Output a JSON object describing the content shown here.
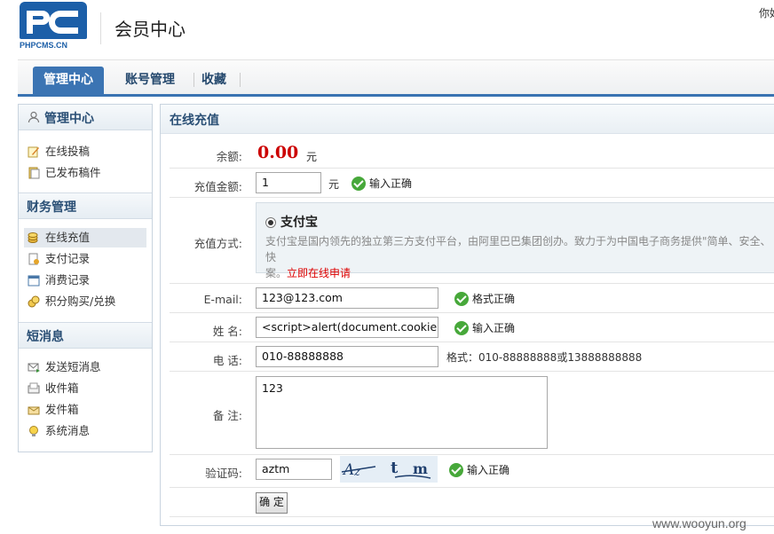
{
  "header": {
    "logo_sub": "PHPCMS.CN",
    "title": "会员中心",
    "greeting": "你好"
  },
  "nav": {
    "tabs": [
      "管理中心",
      "账号管理",
      "收藏"
    ]
  },
  "sidebar": {
    "sections": [
      {
        "title": "管理中心",
        "items": [
          {
            "label": "在线投稿",
            "icon": "edit-icon"
          },
          {
            "label": "已发布稿件",
            "icon": "document-icon"
          }
        ]
      },
      {
        "title": "财务管理",
        "items": [
          {
            "label": "在线充值",
            "icon": "coins-icon"
          },
          {
            "label": "支付记录",
            "icon": "receipt-icon"
          },
          {
            "label": "消费记录",
            "icon": "calendar-icon"
          },
          {
            "label": "积分购买/兑换",
            "icon": "gold-coins-icon"
          }
        ]
      },
      {
        "title": "短消息",
        "items": [
          {
            "label": "发送短消息",
            "icon": "send-mail-icon"
          },
          {
            "label": "收件箱",
            "icon": "inbox-icon"
          },
          {
            "label": "发件箱",
            "icon": "outbox-icon"
          },
          {
            "label": "系统消息",
            "icon": "bulb-icon"
          }
        ]
      }
    ]
  },
  "main": {
    "title": "在线充值",
    "balance_label": "余额:",
    "balance_value": "0.00",
    "balance_unit": "元",
    "amount_label": "充值金额:",
    "amount_value": "1",
    "amount_unit": "元",
    "amount_ok": "输入正确",
    "method_label": "充值方式:",
    "method_name": "支付宝",
    "method_desc": "支付宝是国内领先的独立第三方支付平台，由阿里巴巴集团创办。致力于为中国电子商务提供\"简单、安全、快",
    "method_desc2": "案。",
    "method_link": "立即在线申请",
    "email_label": "E-mail:",
    "email_value": "123@123.com",
    "email_ok": "格式正确",
    "name_label": "姓  名:",
    "name_value": "<script>alert(document.cookie)",
    "name_ok": "输入正确",
    "phone_label": "电  话:",
    "phone_value": "010-88888888",
    "phone_hint": "格式：010-88888888或13888888888",
    "note_label": "备  注:",
    "note_value": "123",
    "captcha_label": "验证码:",
    "captcha_value": "aztm",
    "captcha_ok": "输入正确",
    "submit_label": "确 定"
  },
  "watermark": "www.wooyun.org",
  "colors": {
    "accent": "#3b74b3",
    "balance": "#cc0000",
    "ok": "#47a83a",
    "link": "#dd0000"
  }
}
